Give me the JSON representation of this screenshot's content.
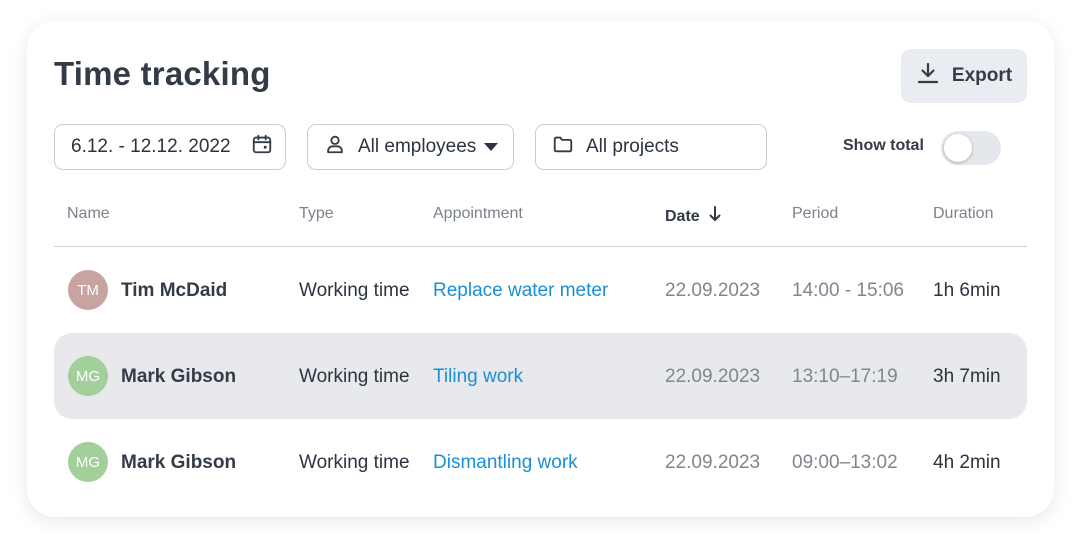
{
  "title": "Time tracking",
  "export_label": "Export",
  "filters": {
    "date_range": "6.12. - 12.12. 2022",
    "employees": "All employees",
    "projects": "All projects"
  },
  "show_total_label": "Show total",
  "show_total_on": false,
  "columns": {
    "name": "Name",
    "type": "Type",
    "appointment": "Appointment",
    "date": "Date",
    "period": "Period",
    "duration": "Duration"
  },
  "rows": [
    {
      "initials": "TM",
      "avatar_color": "#c9a3a0",
      "name": "Tim McDaid",
      "type": "Working time",
      "appointment": "Replace water meter",
      "date": "22.09.2023",
      "period": "14:00 - 15:06",
      "duration": "1h 6min"
    },
    {
      "initials": "MG",
      "avatar_color": "#a3cf9a",
      "name": "Mark Gibson",
      "type": "Working time",
      "appointment": "Tiling work",
      "date": "22.09.2023",
      "period": "13:10–17:19",
      "duration": "3h 7min"
    },
    {
      "initials": "MG",
      "avatar_color": "#a3cf9a",
      "name": "Mark Gibson",
      "type": "Working time",
      "appointment": "Dismantling work",
      "date": "22.09.2023",
      "period": "09:00–13:02",
      "duration": "4h 2min"
    }
  ],
  "colors": {
    "link": "#1a8fd6",
    "row_highlight": "#e7e9ec"
  },
  "icons": {
    "export": "download-icon",
    "date": "calendar-icon",
    "employees": "user-icon",
    "projects": "folder-icon",
    "sort": "arrow-down-icon"
  }
}
